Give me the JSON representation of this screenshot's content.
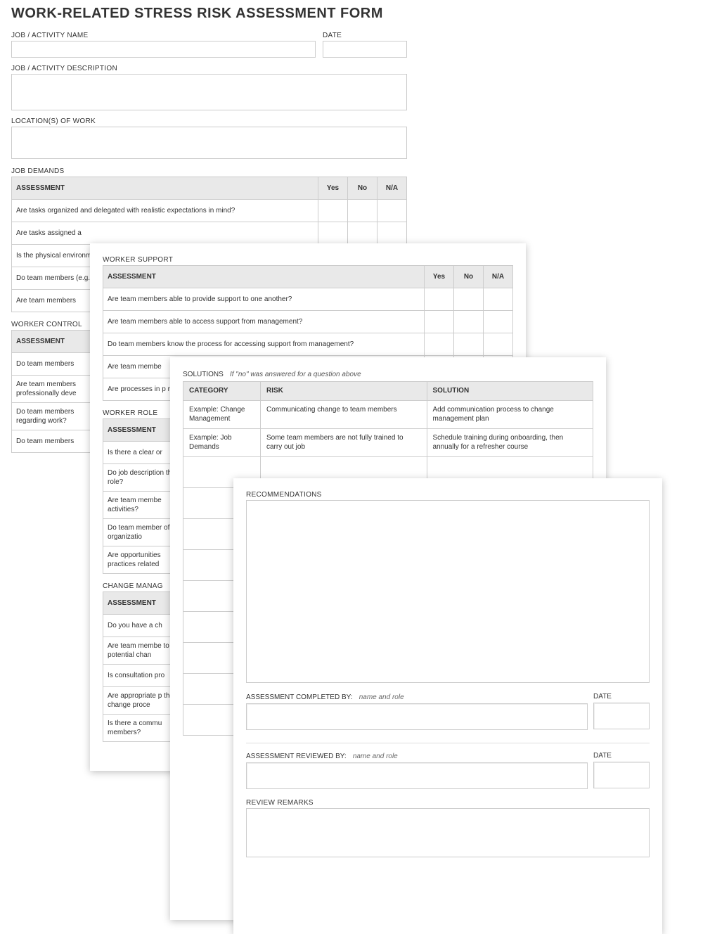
{
  "title": "WORK-RELATED STRESS RISK ASSESSMENT FORM",
  "labels": {
    "job_name": "JOB / ACTIVITY NAME",
    "date": "DATE",
    "job_desc": "JOB / ACTIVITY DESCRIPTION",
    "locations": "LOCATION(S) OF WORK",
    "yes": "Yes",
    "no": "No",
    "na": "N/A",
    "assessment": "ASSESSMENT"
  },
  "job_demands": {
    "title": "JOB DEMANDS",
    "questions": [
      "Are tasks organized and delegated with realistic expectations in mind?",
      "Are tasks assigned a",
      "Is the physical environment (e.g. comfortable, s",
      "Do team members (e.g. equipment, tra",
      "Are team members"
    ]
  },
  "worker_control": {
    "title": "WORKER CONTROL",
    "questions": [
      "Do team members",
      "Are team members professionally deve",
      "Do team members regarding work?",
      "Do team members"
    ]
  },
  "worker_support": {
    "title": "WORKER SUPPORT",
    "questions": [
      "Are team members able to provide support to one another?",
      "Are team members able to access support from management?",
      "Do team members know the process for accessing support from management?",
      "Are team membe",
      "Are processes in p related issues?"
    ]
  },
  "worker_role": {
    "title": "WORKER ROLE",
    "questions": [
      "Is there a clear or",
      "Do job description the role?",
      "Are team membe activities?",
      "Do team member of the organizatio",
      "Are opportunities practices related"
    ]
  },
  "change_mgmt": {
    "title": "CHANGE MANAG",
    "questions": [
      "Do you have a ch",
      "Are team membe to potential chan",
      "Is consultation pro",
      "Are appropriate p the change proce",
      "Is there a commu members?"
    ]
  },
  "solutions": {
    "title": "SOLUTIONS",
    "note": "If \"no\" was answered for a question above",
    "headers": {
      "category": "CATEGORY",
      "risk": "RISK",
      "solution": "SOLUTION"
    },
    "rows": [
      {
        "category": "Example: Change Management",
        "risk": "Communicating change to team members",
        "solution": "Add communication process to change management plan"
      },
      {
        "category": "Example: Job Demands",
        "risk": "Some team members are not fully trained to carry out job",
        "solution": "Schedule training during onboarding, then annually for a refresher course"
      }
    ],
    "blank_rows": 9
  },
  "page4": {
    "recommendations": "RECOMMENDATIONS",
    "completed_by": "ASSESSMENT COMPLETED BY:",
    "reviewed_by": "ASSESSMENT REVIEWED BY:",
    "name_and_role": "name and role",
    "date": "DATE",
    "review_remarks": "REVIEW REMARKS"
  }
}
